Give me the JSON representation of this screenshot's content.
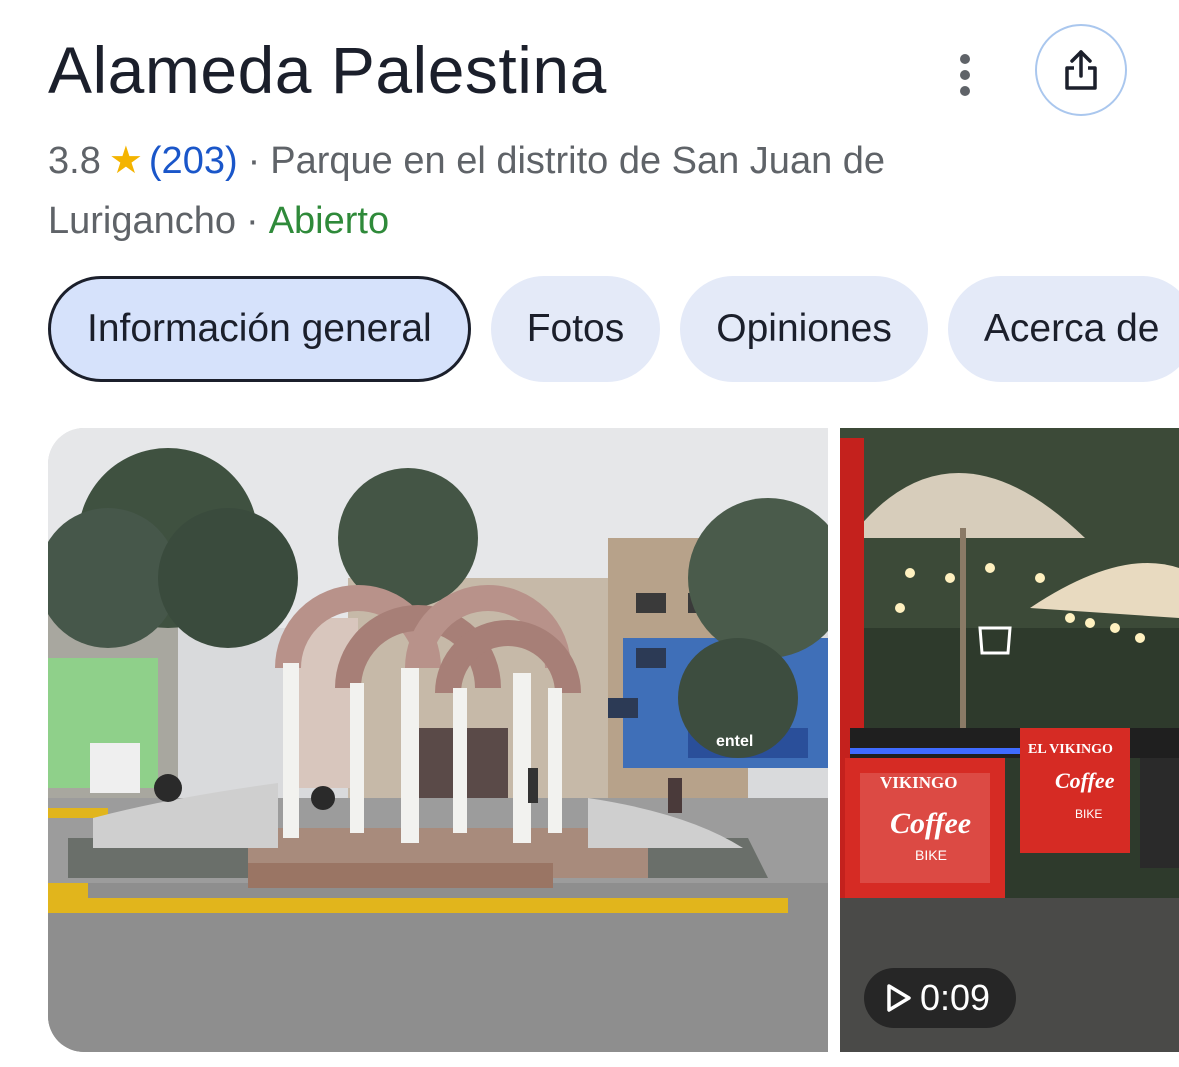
{
  "place": {
    "title": "Alameda Palestina",
    "rating": "3.8",
    "reviews": "(203)",
    "category_line1": "Parque en el distrito de San Juan de",
    "category_line2": "Lurigancho",
    "separator": "·",
    "open_status": "Abierto"
  },
  "tabs": [
    {
      "label": "Información general"
    },
    {
      "label": "Fotos"
    },
    {
      "label": "Opiniones"
    },
    {
      "label": "Acerca de"
    }
  ],
  "media": {
    "video_duration": "0:09",
    "sign_text_1": "EL VIKINGO",
    "sign_text_2": "Coffee",
    "sign_text_3": "BIKE",
    "sign_text_4": "VIKINGO",
    "store_sign": "entel"
  },
  "colors": {
    "star": "#f4b400",
    "review_link": "#1a56c9",
    "open": "#2f8a3a",
    "tab_bg": "#e4eaf8",
    "tab_active_bg": "#d6e2fb"
  },
  "icons": {
    "more": "more-vertical-icon",
    "share": "share-icon",
    "rating_star": "star-icon",
    "play": "play-icon"
  }
}
